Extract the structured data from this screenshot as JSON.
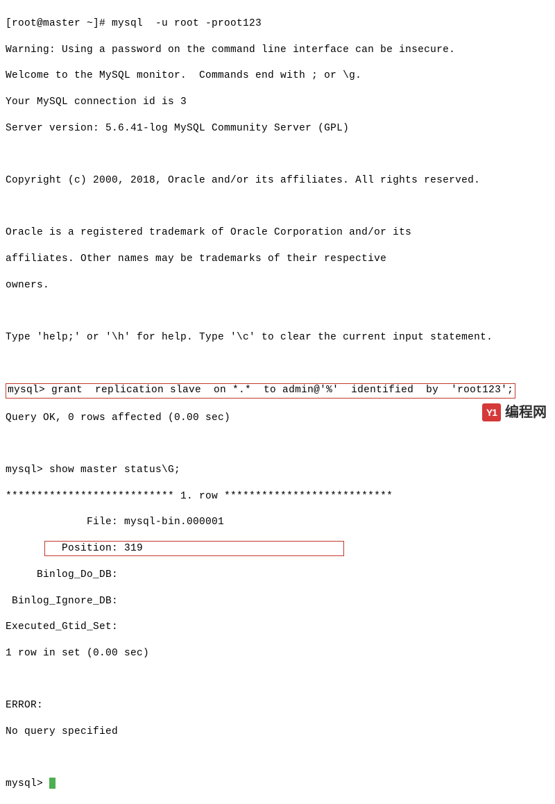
{
  "terminal": {
    "prompt_line": "[root@master ~]# mysql  -u root -proot123",
    "warning": "Warning: Using a password on the command line interface can be insecure.",
    "welcome": "Welcome to the MySQL monitor.  Commands end with ; or \\g.",
    "connection_id": "Your MySQL connection id is 3",
    "server_version": "Server version: 5.6.41-log MySQL Community Server (GPL)",
    "copyright": "Copyright (c) 2000, 2018, Oracle and/or its affiliates. All rights reserved.",
    "trademark1": "Oracle is a registered trademark of Oracle Corporation and/or its",
    "trademark2": "affiliates. Other names may be trademarks of their respective",
    "trademark3": "owners.",
    "help_line": "Type 'help;' or '\\h' for help. Type '\\c' to clear the current input statement.",
    "grant_cmd": "mysql> grant  replication slave  on *.*  to admin@'%'  identified  by  'root123';",
    "grant_result": "Query OK, 0 rows affected (0.00 sec)",
    "show_cmd": "mysql> show master status\\G;",
    "row_header": "*************************** 1. row ***************************",
    "file_line": "             File: mysql-bin.000001",
    "position_line": "         Position: 319",
    "binlog_do": "     Binlog_Do_DB:",
    "binlog_ignore": " Binlog_Ignore_DB:",
    "gtid": "Executed_Gtid_Set:",
    "rows_in_set": "1 row in set (0.00 sec)",
    "error_label": "ERROR:",
    "error_msg": "No query specified",
    "final_prompt": "mysql> "
  },
  "watermark": {
    "badge": "Y1",
    "text": "编程网"
  }
}
